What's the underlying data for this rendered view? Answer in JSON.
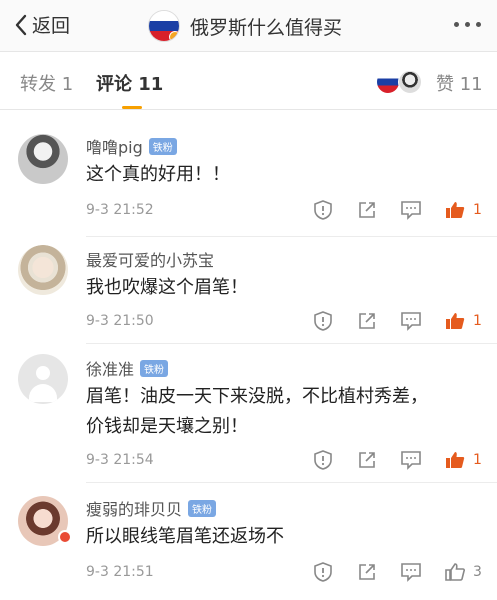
{
  "header": {
    "back_label": "返回",
    "title": "俄罗斯什么值得买"
  },
  "tabs": [
    {
      "label": "转发 1",
      "active": false
    },
    {
      "label": "评论 11",
      "active": true
    },
    {
      "label": "赞 11",
      "active": false
    }
  ],
  "comments": [
    {
      "user": "噜噜pig",
      "badge": "铁粉",
      "text": "这个真的好用！！",
      "time": "9-3 21:52",
      "likes": "1",
      "liked": true
    },
    {
      "user": "最爱可爱的小苏宝",
      "badge": "",
      "text": "我也吹爆这个眉笔！",
      "time": "9-3 21:50",
      "likes": "1",
      "liked": true
    },
    {
      "user": "徐准准",
      "badge": "铁粉",
      "text_line1": "眉笔！油皮一天下来没脱，不比植村秀差，",
      "text_line2": "价钱却是天壤之别！",
      "time": "9-3 21:54",
      "likes": "1",
      "liked": true
    },
    {
      "user": "瘦弱的琲贝贝",
      "badge": "铁粉",
      "text": "所以眼线笔眉笔还返场不",
      "time": "9-3 21:51",
      "likes": "3",
      "liked": false
    }
  ],
  "icons": {
    "accent": "#f7a000",
    "like_active": "#e55b1e"
  }
}
